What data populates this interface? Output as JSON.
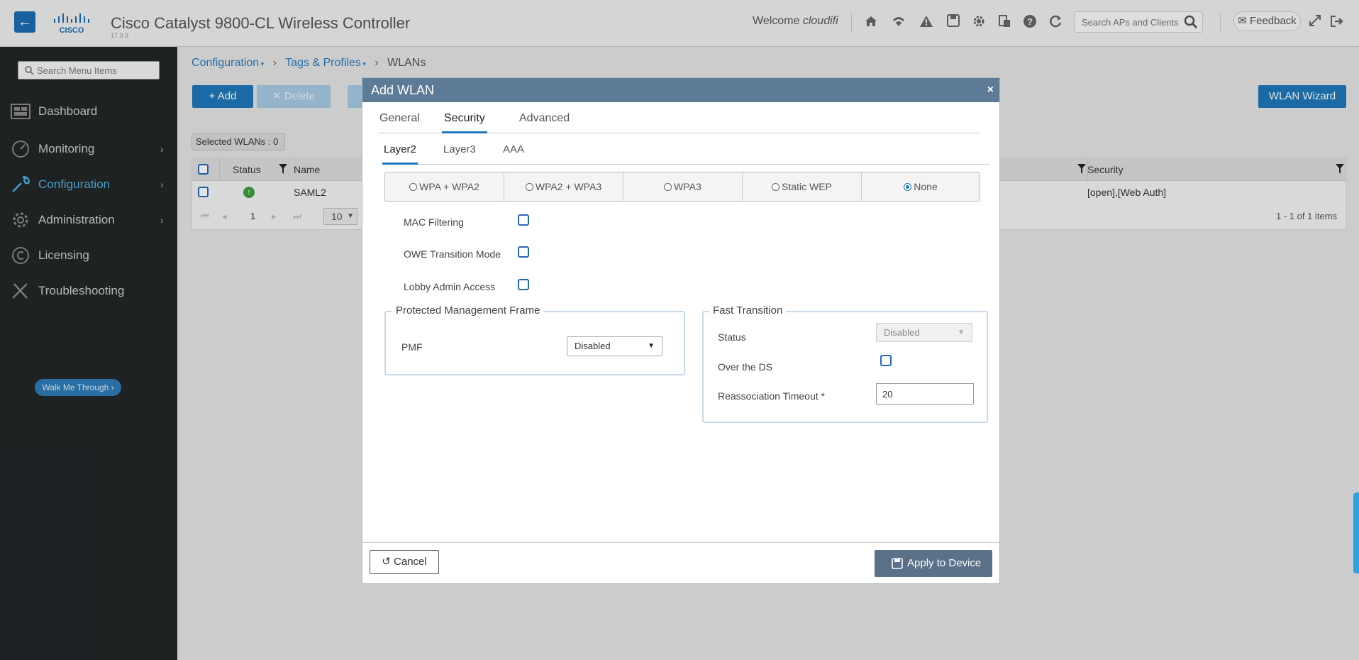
{
  "header": {
    "title": "Cisco Catalyst 9800-CL Wireless Controller",
    "version": "17.9.3",
    "welcome_prefix": "Welcome",
    "username": "cloudifi",
    "search_placeholder": "Search APs and Clients",
    "feedback_label": "Feedback",
    "logo_text": "CISCO"
  },
  "sidebar": {
    "search_placeholder": "Search Menu Items",
    "items": [
      {
        "label": "Dashboard",
        "icon": "dashboard-icon"
      },
      {
        "label": "Monitoring",
        "icon": "monitoring-icon"
      },
      {
        "label": "Configuration",
        "icon": "wrench-icon"
      },
      {
        "label": "Administration",
        "icon": "gear-icon"
      },
      {
        "label": "Licensing",
        "icon": "licensing-icon"
      },
      {
        "label": "Troubleshooting",
        "icon": "tools-icon"
      }
    ],
    "walkme_label": "Walk Me Through ›"
  },
  "breadcrumb": {
    "items": [
      "Configuration",
      "Tags & Profiles",
      "WLANs"
    ]
  },
  "toolbar": {
    "add_label": "+ Add",
    "delete_label": "✕ Delete",
    "wizard_label": "WLAN Wizard"
  },
  "grid": {
    "selected_label": "Selected WLANs : 0",
    "columns": [
      "Status",
      "Name",
      "Security"
    ],
    "rows": [
      {
        "name": "SAML2",
        "security": "[open],[Web Auth]"
      }
    ],
    "page": "1",
    "page_size": "10",
    "range_text": "1 - 1 of 1 items"
  },
  "modal": {
    "title": "Add WLAN",
    "close": "×",
    "tabs": [
      "General",
      "Security",
      "Advanced"
    ],
    "subtabs": [
      "Layer2",
      "Layer3",
      "AAA"
    ],
    "security_modes": [
      "WPA + WPA2",
      "WPA2 + WPA3",
      "WPA3",
      "Static WEP",
      "None"
    ],
    "selected_mode": "None",
    "options": {
      "mac_filtering": "MAC Filtering",
      "owe_transition": "OWE Transition Mode",
      "lobby_admin": "Lobby Admin Access"
    },
    "pmf": {
      "legend": "Protected Management Frame",
      "label": "PMF",
      "value": "Disabled"
    },
    "fast_transition": {
      "legend": "Fast Transition",
      "status_label": "Status",
      "status_value": "Disabled",
      "over_ds_label": "Over the DS",
      "reassoc_label": "Reassociation Timeout *",
      "reassoc_value": "20"
    },
    "cancel_label": "Cancel",
    "apply_label": "Apply to Device"
  },
  "colors": {
    "accent": "#1f76b8",
    "modal_header": "#5d7a96",
    "sidebar_bg": "#232628",
    "status_ok": "#3a9c3a"
  }
}
